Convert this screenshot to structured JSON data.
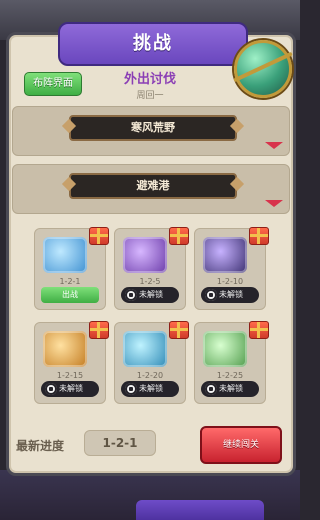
{
  "header": {
    "title": "挑战"
  },
  "top": {
    "formation_button": "布阵界面",
    "stage_title": "外出讨伐",
    "stage_subtitle": "周回一"
  },
  "sections": [
    {
      "label": "寒风荒野"
    },
    {
      "label": "避难港"
    }
  ],
  "stages": [
    {
      "level": "1-2-1",
      "status": "出战",
      "locked": false
    },
    {
      "level": "1-2-5",
      "status": "未解锁",
      "locked": true
    },
    {
      "level": "1-2-10",
      "status": "未解锁",
      "locked": true
    },
    {
      "level": "1-2-15",
      "status": "未解锁",
      "locked": true
    },
    {
      "level": "1-2-20",
      "status": "未解锁",
      "locked": true
    },
    {
      "level": "1-2-25",
      "status": "未解锁",
      "locked": true
    }
  ],
  "footer": {
    "progress_label": "最新进度",
    "progress_value": "1-2-1",
    "continue_button": "继续闯关"
  },
  "colors": {
    "title_banner": "#7b55cc",
    "accent_red": "#d8334c",
    "green": "#4fbf52"
  }
}
